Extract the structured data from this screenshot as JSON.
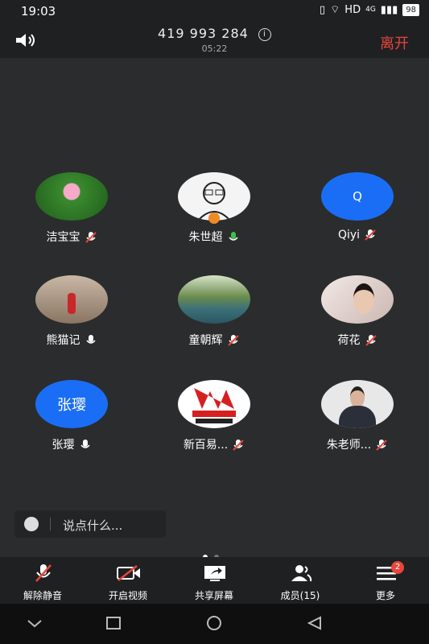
{
  "status": {
    "time": "19:03",
    "network": "HD",
    "net_type": "4G",
    "battery": "98"
  },
  "header": {
    "meeting_id": "419 993 284",
    "timer": "05:22",
    "leave_label": "离开"
  },
  "participants": [
    {
      "name": "洁宝宝",
      "avatar": "lotus photo",
      "mic": "muted"
    },
    {
      "name": "朱世超",
      "avatar": "sketch portrait",
      "mic": "speaking"
    },
    {
      "name": "Qiyi",
      "avatar_text": "Q",
      "mic": "muted"
    },
    {
      "name": "熊猫记",
      "avatar": "corridor photo",
      "mic": "on"
    },
    {
      "name": "童朝辉",
      "avatar": "lake photo",
      "mic": "muted"
    },
    {
      "name": "荷花",
      "avatar": "selfie photo",
      "mic": "muted"
    },
    {
      "name": "张璎",
      "avatar_text": "张璎",
      "mic": "on"
    },
    {
      "name": "新百易...",
      "avatar": "JSZG logo",
      "mic": "muted"
    },
    {
      "name": "朱老师...",
      "avatar": "man in suit",
      "mic": "muted"
    }
  ],
  "chat": {
    "placeholder": "说点什么..."
  },
  "toolbar": {
    "unmute": "解除静音",
    "video": "开启视频",
    "share": "共享屏幕",
    "members": "成员(15)",
    "more": "更多",
    "more_badge": "2"
  },
  "colors": {
    "accent_blue": "#1a6ef5",
    "leave_red": "#e6463c",
    "bg": "#2b2c2e",
    "bar": "#1f2022"
  }
}
